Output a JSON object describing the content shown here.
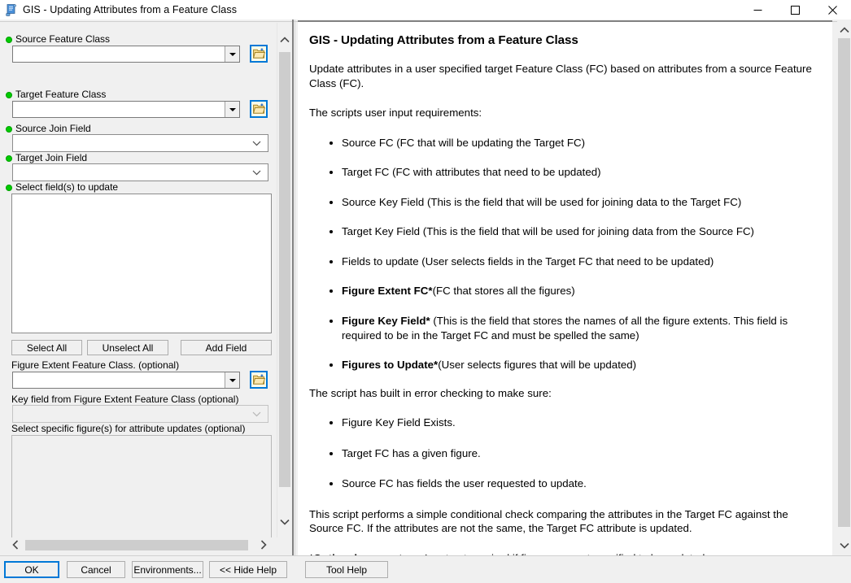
{
  "window": {
    "title": "GIS - Updating Attributes from a Feature Class",
    "icon": "script-tool-icon",
    "controls": {
      "minimize": "minimize-icon",
      "maximize": "maximize-icon",
      "close": "close-icon"
    }
  },
  "parameters": [
    {
      "id": "source-feature-class",
      "label": "Source Feature Class",
      "required": true,
      "control": "combo-browse",
      "value": "",
      "browse_icon": "folder-open-icon"
    },
    {
      "id": "target-feature-class",
      "label": "Target Feature Class",
      "required": true,
      "control": "combo-browse",
      "value": "",
      "browse_icon": "folder-open-icon"
    },
    {
      "id": "source-join-field",
      "label": "Source Join Field",
      "required": true,
      "control": "combo-flat",
      "value": "",
      "enabled": true
    },
    {
      "id": "target-join-field",
      "label": "Target Join Field",
      "required": true,
      "control": "combo-flat",
      "value": "",
      "enabled": true
    },
    {
      "id": "select-fields-to-update",
      "label": "Select field(s) to update",
      "required": true,
      "control": "listbox",
      "items": [],
      "enabled": true
    },
    {
      "id": "figure-extent-feature-class",
      "label": "Figure Extent Feature Class. (optional)",
      "required": false,
      "control": "combo-browse",
      "value": "",
      "browse_icon": "folder-open-icon"
    },
    {
      "id": "key-field-from-figure-extent",
      "label": "Key field from Figure Extent Feature Class (optional)",
      "required": false,
      "control": "combo-flat",
      "value": "",
      "enabled": false
    },
    {
      "id": "select-specific-figures",
      "label": "Select specific figure(s) for attribute updates (optional)",
      "required": false,
      "control": "listbox",
      "items": [],
      "enabled": false
    }
  ],
  "field_buttons": {
    "select_all": "Select All",
    "unselect_all": "Unselect All",
    "add_field": "Add Field"
  },
  "help": {
    "title": "GIS - Updating Attributes from a Feature Class",
    "intro": "Update attributes in a user specified target Feature Class (FC) based on attributes from a source Feature Class (FC).",
    "requirements_heading": "The scripts user input requirements:",
    "requirements": [
      {
        "bold": "",
        "text": "Source FC (FC that will be updating the Target FC)"
      },
      {
        "bold": "",
        "text": "Target FC (FC with attributes that need to be updated)"
      },
      {
        "bold": "",
        "text": "Source Key Field (This is the field that will be used for joining data to the Target FC)"
      },
      {
        "bold": "",
        "text": "Target Key Field (This is the field that will be used for joining data from the Source FC)"
      },
      {
        "bold": "",
        "text": "Fields to update (User selects fields in the Target FC that need to be updated)"
      },
      {
        "bold": "Figure Extent FC*",
        "text": "(FC that stores all the figures)"
      },
      {
        "bold": "Figure Key Field*",
        "text": " (This is the field that stores the names of all the figure extents. This field is required to be in the Target FC and must be spelled the same)"
      },
      {
        "bold": "Figures to Update*",
        "text": "(User selects figures that will be updated)"
      }
    ],
    "error_heading": "The script has built in error checking to make sure:",
    "error_checks": [
      "Figure Key Field Exists.",
      "Target FC has a given figure.",
      "Source FC has fields the user requested to update."
    ],
    "summary": "This script performs a simple conditional check comparing the attributes in the Target FC against the Source FC. If the attributes are not the same, the Target FC attribute is updated.",
    "footnote_bold": "*Optional parameters",
    "footnote_rest": ". Input not required if figures are not specified to be updated."
  },
  "footer": {
    "ok": "OK",
    "cancel": "Cancel",
    "environments": "Environments...",
    "hide_help": "<< Hide Help",
    "tool_help": "Tool Help"
  },
  "colors": {
    "accent": "#0078d7",
    "required_dot": "#00cc00",
    "dialog_bg": "#f0f0f0",
    "scroll_thumb": "#cdcdcd"
  }
}
